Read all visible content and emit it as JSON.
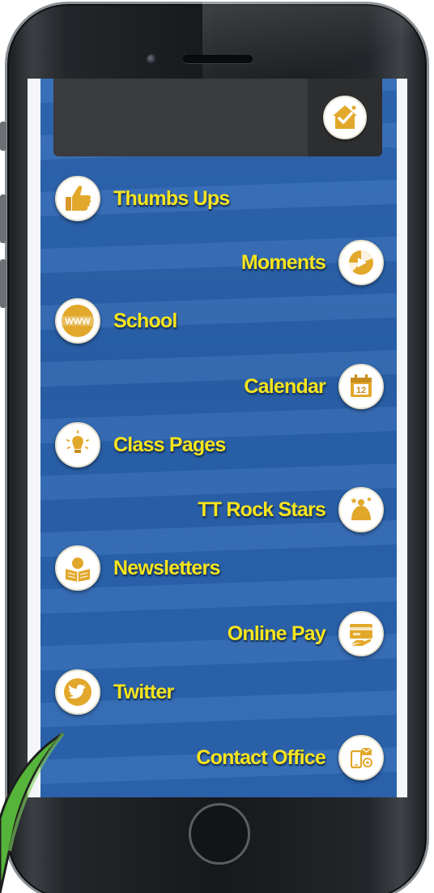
{
  "colors": {
    "accent_yellow": "#f7e41e",
    "icon_gold": "#e2a82b",
    "panel_blue": "#2c66b2",
    "header_dark": "#3a3b3d"
  },
  "header": {
    "home_icon": "home-check-icon"
  },
  "menu": {
    "items": [
      {
        "label": "Thumbs Ups",
        "icon": "thumbs-up-icon",
        "side": "left"
      },
      {
        "label": "Moments",
        "icon": "photo-moments-icon",
        "side": "right"
      },
      {
        "label": "School",
        "icon": "www-icon",
        "side": "left"
      },
      {
        "label": "Calendar",
        "icon": "calendar-icon",
        "side": "right"
      },
      {
        "label": "Class Pages",
        "icon": "class-lightbulb-icon",
        "side": "left"
      },
      {
        "label": "TT Rock Stars",
        "icon": "rock-stars-icon",
        "side": "right"
      },
      {
        "label": "Newsletters",
        "icon": "newsletter-icon",
        "side": "left"
      },
      {
        "label": "Online Pay",
        "icon": "payment-card-icon",
        "side": "right"
      },
      {
        "label": "Twitter",
        "icon": "twitter-icon",
        "side": "left"
      },
      {
        "label": "Contact Office",
        "icon": "contact-icon",
        "side": "right"
      }
    ]
  },
  "calendar_icon_day": "12",
  "school_icon_text": "WWW"
}
